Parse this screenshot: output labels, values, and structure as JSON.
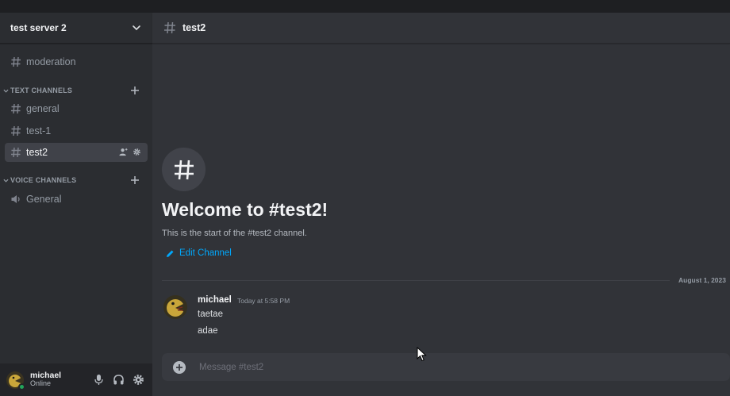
{
  "server": {
    "name": "test server 2"
  },
  "channels": {
    "top": {
      "label": "moderation",
      "icon": "hash-icon"
    },
    "text_category": "TEXT CHANNELS",
    "text": [
      {
        "label": "general"
      },
      {
        "label": "test-1"
      },
      {
        "label": "test2",
        "active": true
      }
    ],
    "voice_category": "VOICE CHANNELS",
    "voice": [
      {
        "label": "General",
        "icon": "speaker-icon"
      }
    ]
  },
  "user": {
    "name": "michael",
    "status": "Online"
  },
  "channel_header": {
    "title": "test2"
  },
  "welcome": {
    "title": "Welcome to #test2!",
    "subtitle": "This is the start of the #test2 channel.",
    "edit_label": "Edit Channel"
  },
  "divider_date": "August 1, 2023",
  "messages": [
    {
      "author": "michael",
      "time": "Today at 5:58 PM",
      "lines": [
        "taetae",
        "adae"
      ]
    }
  ],
  "composer": {
    "placeholder": "Message #test2"
  },
  "colors": {
    "accent": "#00a8fc",
    "online": "#23a55a",
    "sidebar": "#2b2d31",
    "chat": "#313338"
  }
}
